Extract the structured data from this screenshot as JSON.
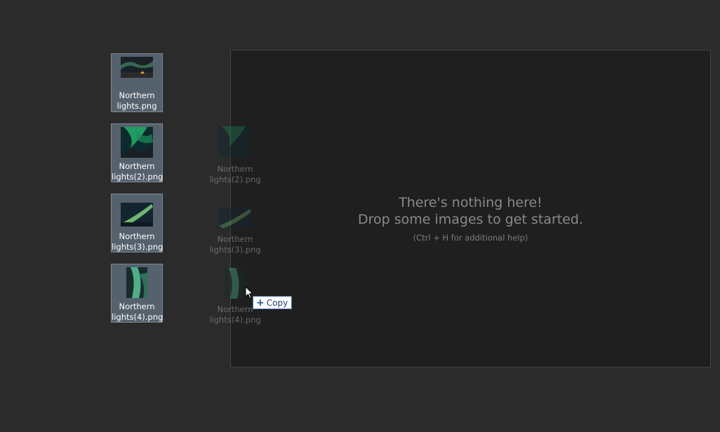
{
  "desktop_icons": [
    {
      "label_line1": "Northern",
      "label_line2": "lights.png",
      "icon": "aurora-night-camp-thumbnail"
    },
    {
      "label_line1": "Northern",
      "label_line2": "lights(2).png",
      "icon": "aurora-green-sky-thumbnail"
    },
    {
      "label_line1": "Northern",
      "label_line2": "lights(3).png",
      "icon": "aurora-band-thumbnail"
    },
    {
      "label_line1": "Northern",
      "label_line2": "lights(4).png",
      "icon": "aurora-vertical-thumbnail"
    }
  ],
  "drag_ghosts": [
    {
      "label_line1": "Northern",
      "label_line2": "lights(2).png"
    },
    {
      "label_line1": "Northern",
      "label_line2": "lights(3).png"
    },
    {
      "label_line1": "Northern",
      "label_line2": "lights(4).png"
    }
  ],
  "dropzone": {
    "line1": "There's nothing here!",
    "line2": "Drop some images to get started.",
    "hint": "(Ctrl + H for additional help)"
  },
  "drag_tooltip": {
    "symbol": "+",
    "label": "Copy"
  },
  "colors": {
    "background": "#2b2b2b",
    "dropzone_bg": "#1f1f1f",
    "icon_tile": "#55616d",
    "tooltip_border": "#4a6ea9"
  }
}
